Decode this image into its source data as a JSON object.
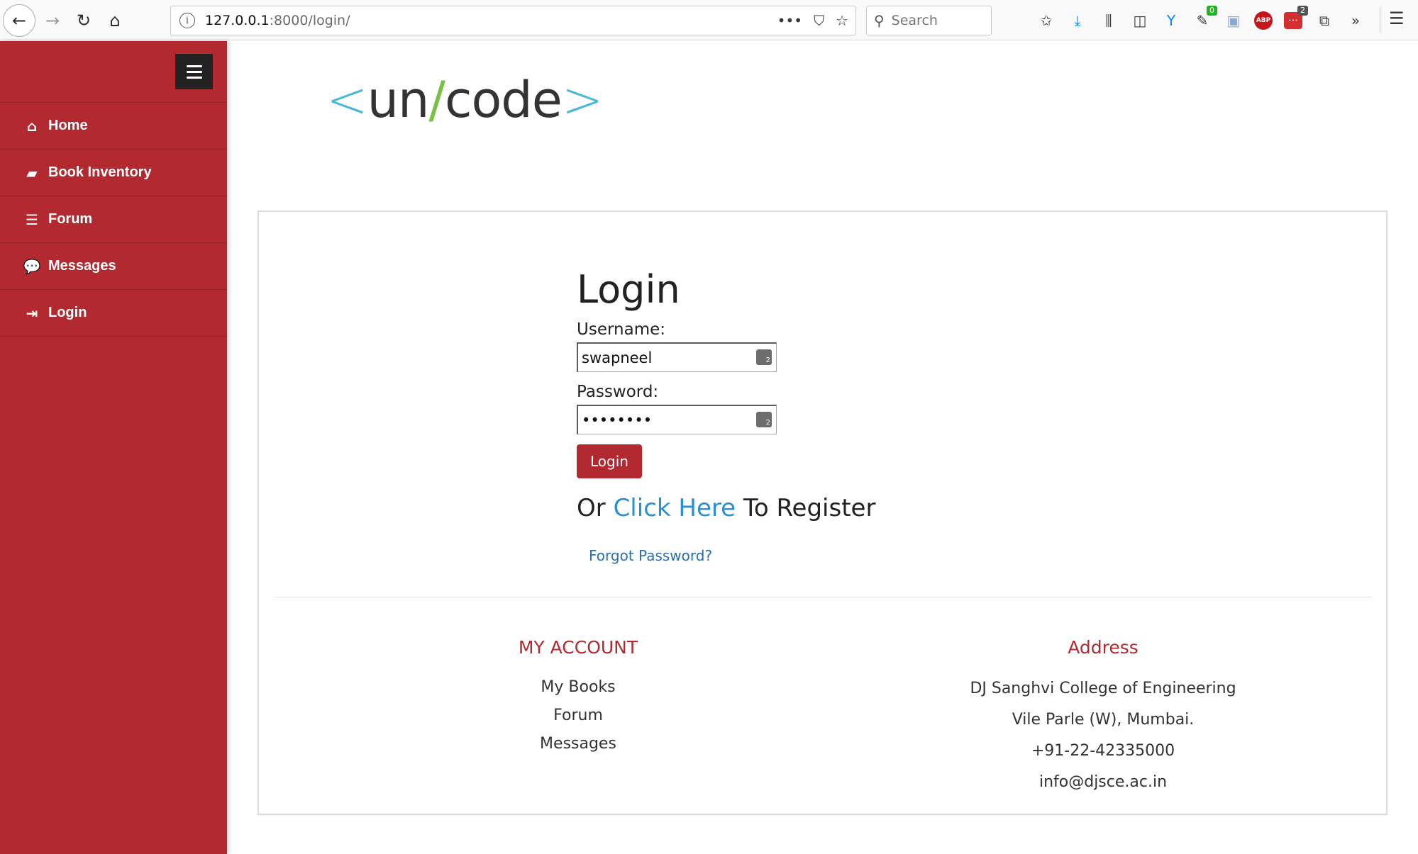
{
  "browser": {
    "url_host": "127.0.0.1",
    "url_rest": ":8000/login/",
    "search_placeholder": "Search",
    "badge_green": "0",
    "badge_gray": "2",
    "abp_label": "ABP",
    "icons": [
      "back-icon",
      "forward-icon",
      "reload-icon",
      "home-icon",
      "info-icon",
      "more-icon",
      "pocket-icon",
      "bookmark-star-icon",
      "search-icon",
      "bookmarks-icon",
      "download-icon",
      "library-icon",
      "sidebar-icon",
      "extension-icon",
      "adblock-icon",
      "menu-icon"
    ]
  },
  "sidebar": {
    "bg_color": "#b22a2f",
    "items": [
      {
        "label": "Home",
        "icon": "home-icon"
      },
      {
        "label": "Book Inventory",
        "icon": "book-icon"
      },
      {
        "label": "Forum",
        "icon": "list-icon"
      },
      {
        "label": "Messages",
        "icon": "comments-icon"
      },
      {
        "label": "Login",
        "icon": "sign-in-icon"
      }
    ]
  },
  "logo": {
    "open": "<",
    "un": "un",
    "slash": "/",
    "code": "code",
    "close": ">"
  },
  "login": {
    "title": "Login",
    "username_label": "Username:",
    "username_value": "swapneel",
    "password_label": "Password:",
    "password_value": "••••••••",
    "keepass_badge": "2",
    "button_label": "Login",
    "register_prefix": "Or",
    "register_link": "Click Here",
    "register_suffix": "To Register",
    "forgot_label": "Forgot Password?"
  },
  "footer": {
    "account_heading": "MY ACCOUNT",
    "account_links": [
      "My Books",
      "Forum",
      "Messages"
    ],
    "address_heading": "Address",
    "address_lines": [
      "DJ Sanghvi College of Engineering",
      "Vile Parle (W), Mumbai.",
      "+91-22-42335000",
      "info@djsce.ac.in"
    ]
  },
  "colors": {
    "accent": "#b22a2f",
    "link": "#2b8fd4",
    "logo_bracket": "#48b8d6",
    "logo_slash": "#7ac143"
  }
}
